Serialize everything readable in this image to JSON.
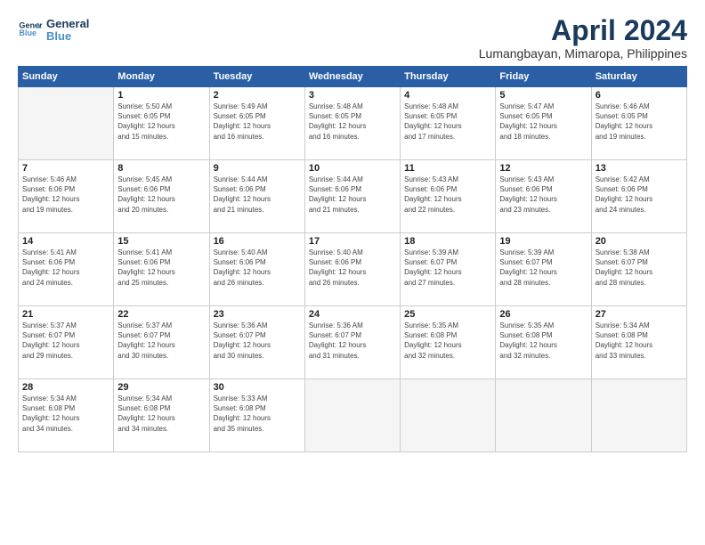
{
  "header": {
    "logo_line1": "General",
    "logo_line2": "Blue",
    "month_year": "April 2024",
    "location": "Lumangbayan, Mimaropa, Philippines"
  },
  "weekdays": [
    "Sunday",
    "Monday",
    "Tuesday",
    "Wednesday",
    "Thursday",
    "Friday",
    "Saturday"
  ],
  "weeks": [
    [
      {
        "day": "",
        "info": ""
      },
      {
        "day": "1",
        "info": "Sunrise: 5:50 AM\nSunset: 6:05 PM\nDaylight: 12 hours\nand 15 minutes."
      },
      {
        "day": "2",
        "info": "Sunrise: 5:49 AM\nSunset: 6:05 PM\nDaylight: 12 hours\nand 16 minutes."
      },
      {
        "day": "3",
        "info": "Sunrise: 5:48 AM\nSunset: 6:05 PM\nDaylight: 12 hours\nand 16 minutes."
      },
      {
        "day": "4",
        "info": "Sunrise: 5:48 AM\nSunset: 6:05 PM\nDaylight: 12 hours\nand 17 minutes."
      },
      {
        "day": "5",
        "info": "Sunrise: 5:47 AM\nSunset: 6:05 PM\nDaylight: 12 hours\nand 18 minutes."
      },
      {
        "day": "6",
        "info": "Sunrise: 5:46 AM\nSunset: 6:05 PM\nDaylight: 12 hours\nand 19 minutes."
      }
    ],
    [
      {
        "day": "7",
        "info": "Sunrise: 5:46 AM\nSunset: 6:06 PM\nDaylight: 12 hours\nand 19 minutes."
      },
      {
        "day": "8",
        "info": "Sunrise: 5:45 AM\nSunset: 6:06 PM\nDaylight: 12 hours\nand 20 minutes."
      },
      {
        "day": "9",
        "info": "Sunrise: 5:44 AM\nSunset: 6:06 PM\nDaylight: 12 hours\nand 21 minutes."
      },
      {
        "day": "10",
        "info": "Sunrise: 5:44 AM\nSunset: 6:06 PM\nDaylight: 12 hours\nand 21 minutes."
      },
      {
        "day": "11",
        "info": "Sunrise: 5:43 AM\nSunset: 6:06 PM\nDaylight: 12 hours\nand 22 minutes."
      },
      {
        "day": "12",
        "info": "Sunrise: 5:43 AM\nSunset: 6:06 PM\nDaylight: 12 hours\nand 23 minutes."
      },
      {
        "day": "13",
        "info": "Sunrise: 5:42 AM\nSunset: 6:06 PM\nDaylight: 12 hours\nand 24 minutes."
      }
    ],
    [
      {
        "day": "14",
        "info": "Sunrise: 5:41 AM\nSunset: 6:06 PM\nDaylight: 12 hours\nand 24 minutes."
      },
      {
        "day": "15",
        "info": "Sunrise: 5:41 AM\nSunset: 6:06 PM\nDaylight: 12 hours\nand 25 minutes."
      },
      {
        "day": "16",
        "info": "Sunrise: 5:40 AM\nSunset: 6:06 PM\nDaylight: 12 hours\nand 26 minutes."
      },
      {
        "day": "17",
        "info": "Sunrise: 5:40 AM\nSunset: 6:06 PM\nDaylight: 12 hours\nand 26 minutes."
      },
      {
        "day": "18",
        "info": "Sunrise: 5:39 AM\nSunset: 6:07 PM\nDaylight: 12 hours\nand 27 minutes."
      },
      {
        "day": "19",
        "info": "Sunrise: 5:39 AM\nSunset: 6:07 PM\nDaylight: 12 hours\nand 28 minutes."
      },
      {
        "day": "20",
        "info": "Sunrise: 5:38 AM\nSunset: 6:07 PM\nDaylight: 12 hours\nand 28 minutes."
      }
    ],
    [
      {
        "day": "21",
        "info": "Sunrise: 5:37 AM\nSunset: 6:07 PM\nDaylight: 12 hours\nand 29 minutes."
      },
      {
        "day": "22",
        "info": "Sunrise: 5:37 AM\nSunset: 6:07 PM\nDaylight: 12 hours\nand 30 minutes."
      },
      {
        "day": "23",
        "info": "Sunrise: 5:36 AM\nSunset: 6:07 PM\nDaylight: 12 hours\nand 30 minutes."
      },
      {
        "day": "24",
        "info": "Sunrise: 5:36 AM\nSunset: 6:07 PM\nDaylight: 12 hours\nand 31 minutes."
      },
      {
        "day": "25",
        "info": "Sunrise: 5:35 AM\nSunset: 6:08 PM\nDaylight: 12 hours\nand 32 minutes."
      },
      {
        "day": "26",
        "info": "Sunrise: 5:35 AM\nSunset: 6:08 PM\nDaylight: 12 hours\nand 32 minutes."
      },
      {
        "day": "27",
        "info": "Sunrise: 5:34 AM\nSunset: 6:08 PM\nDaylight: 12 hours\nand 33 minutes."
      }
    ],
    [
      {
        "day": "28",
        "info": "Sunrise: 5:34 AM\nSunset: 6:08 PM\nDaylight: 12 hours\nand 34 minutes."
      },
      {
        "day": "29",
        "info": "Sunrise: 5:34 AM\nSunset: 6:08 PM\nDaylight: 12 hours\nand 34 minutes."
      },
      {
        "day": "30",
        "info": "Sunrise: 5:33 AM\nSunset: 6:08 PM\nDaylight: 12 hours\nand 35 minutes."
      },
      {
        "day": "",
        "info": ""
      },
      {
        "day": "",
        "info": ""
      },
      {
        "day": "",
        "info": ""
      },
      {
        "day": "",
        "info": ""
      }
    ]
  ]
}
